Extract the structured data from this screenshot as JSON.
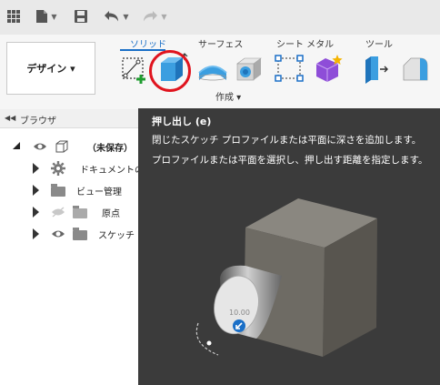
{
  "topbar": {
    "icons": [
      "grid-icon",
      "file-icon",
      "save-icon",
      "undo-icon",
      "redo-icon"
    ]
  },
  "ribbon": {
    "tabs": [
      "ソリッド",
      "サーフェス",
      "シート メタル",
      "ツール"
    ],
    "active_tab": "ソリッド",
    "workspace_button": "デザイン ▾",
    "group_label": "作成 ▾",
    "tools": [
      "create-sketch-icon",
      "extrude-icon",
      "revolve-icon",
      "hole-icon",
      "pattern-icon",
      "component-icon",
      "press-pull-icon",
      "fillet-icon"
    ],
    "highlight_color": "#e0141e",
    "accent_color": "#1a6fc7"
  },
  "browser": {
    "title": "ブラウザ",
    "items": [
      {
        "label": "（未保存）"
      },
      {
        "label": "ドキュメントの設"
      },
      {
        "label": "ビュー管理"
      },
      {
        "label": "原点"
      },
      {
        "label": "スケッチ"
      }
    ]
  },
  "tooltip": {
    "title": "押し出し (e)",
    "description": "閉じたスケッチ プロファイルまたは平面に深さを追加します。",
    "instruction": "プロファイルまたは平面を選択し、押し出す距離を指定します。",
    "preview_value": "10.00"
  }
}
